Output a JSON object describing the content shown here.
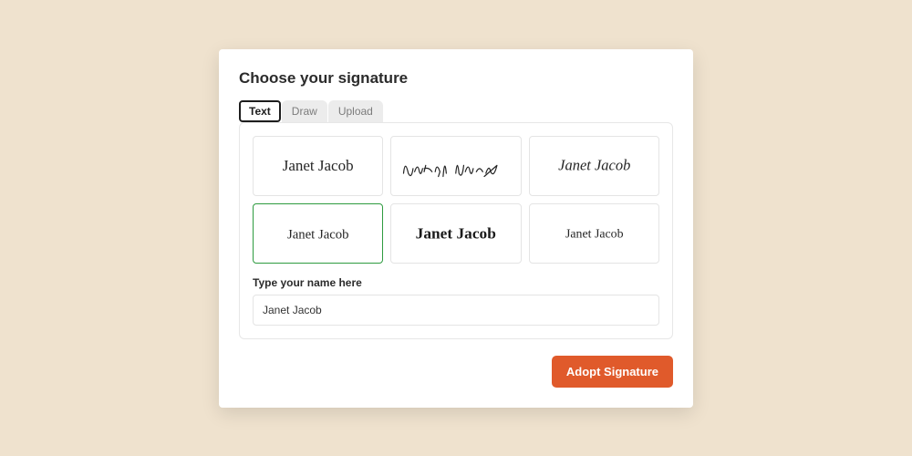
{
  "title": "Choose your signature",
  "tabs": {
    "text": "Text",
    "draw": "Draw",
    "upload": "Upload"
  },
  "signature_name": "Janet Jacob",
  "selected_index": 3,
  "style_count": 6,
  "name_field": {
    "label": "Type your name here",
    "value": "Janet Jacob"
  },
  "adopt_button": "Adopt Signature"
}
